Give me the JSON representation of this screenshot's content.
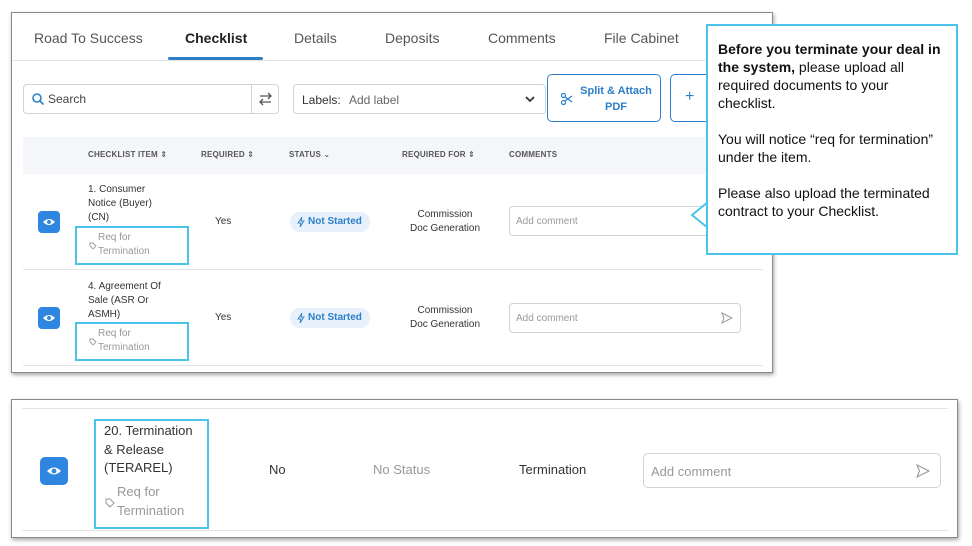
{
  "tabs": [
    {
      "label": "Road To Success"
    },
    {
      "label": "Checklist",
      "active": true
    },
    {
      "label": "Details"
    },
    {
      "label": "Deposits"
    },
    {
      "label": "Comments"
    },
    {
      "label": "File Cabinet"
    }
  ],
  "toolbar": {
    "search_placeholder": "Search",
    "labels_label": "Labels:",
    "labels_placeholder": "Add label",
    "split_attach_line1": "Split & Attach",
    "split_attach_line2": "PDF",
    "add_symbol": "+"
  },
  "table": {
    "headers": {
      "item": "CHECKLIST ITEM ⇕",
      "required": "REQUIRED ⇕",
      "status": "STATUS ⌄",
      "required_for": "REQUIRED FOR ⇕",
      "comments": "COMMENTS"
    },
    "rows": [
      {
        "name_lines": [
          "1. Consumer",
          "Notice (Buyer)",
          "(CN)"
        ],
        "label_line1": "Req for",
        "label_line2": "Termination",
        "required": "Yes",
        "status": "Not Started",
        "required_for_line1": "Commission",
        "required_for_line2": "Doc Generation",
        "comment_placeholder": "Add comment"
      },
      {
        "name_lines": [
          "4. Agreement Of",
          "Sale (ASR Or",
          "ASMH)"
        ],
        "label_line1": "Req for",
        "label_line2": "Termination",
        "required": "Yes",
        "status": "Not Started",
        "required_for_line1": "Commission",
        "required_for_line2": "Doc Generation",
        "comment_placeholder": "Add comment"
      }
    ]
  },
  "callout": {
    "bold": "Before you terminate your deal in the system,",
    "p1_rest": " please upload all required documents to your checklist.",
    "p2": "You will notice “req for termination” under the item.",
    "p3": "Please also upload the terminated contract to your Checklist."
  },
  "bottom_row": {
    "name_lines": [
      "20. Termination",
      "& Release",
      "(TERAREL)"
    ],
    "label_line1": "Req for",
    "label_line2": "Termination",
    "required": "No",
    "status": "No Status",
    "required_for": "Termination",
    "comment_placeholder": "Add comment"
  },
  "colors": {
    "accent": "#2d7fc7",
    "eye_button": "#2f86e0",
    "highlight": "#4cc3e8"
  },
  "icons": [
    "search-icon",
    "swap-icon",
    "chevron-down-icon",
    "scissors-icon",
    "eye-icon",
    "tag-icon",
    "lightning-icon",
    "send-icon"
  ]
}
